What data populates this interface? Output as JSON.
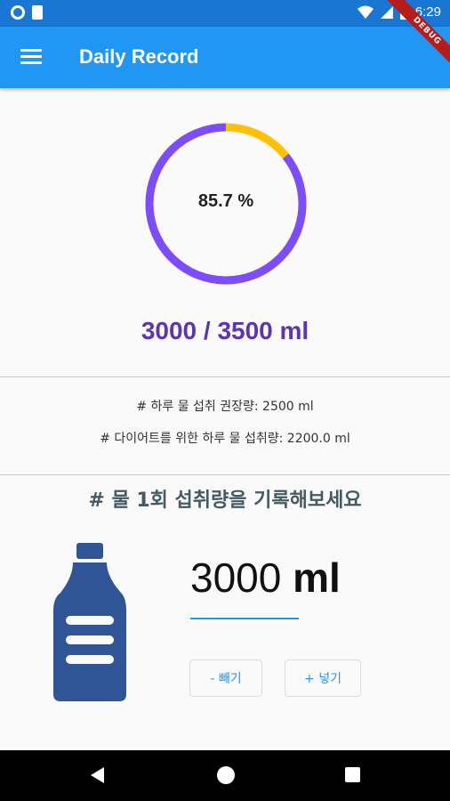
{
  "status": {
    "time": "6:29"
  },
  "appbar": {
    "title": "Daily Record",
    "debug_label": "DEBUG"
  },
  "gauge": {
    "percent_text": "85.7 %",
    "fraction": 0.857,
    "progress_color": "#7c4dff",
    "remainder_color": "#ffc107"
  },
  "totals": {
    "text": "3000 / 3500 ml"
  },
  "recommend": {
    "daily": "# 하루 물 섭취 권장량:  2500  ml",
    "diet": "# 다이어트를 위한 하루 물 섭취량: 2200.0   ml"
  },
  "record": {
    "heading": "# 물 1회 섭취량을 기록해보세요",
    "amount_value": "3000",
    "amount_unit": "ml",
    "minus_label": "- 빼기",
    "plus_label": "+ 넣기"
  }
}
